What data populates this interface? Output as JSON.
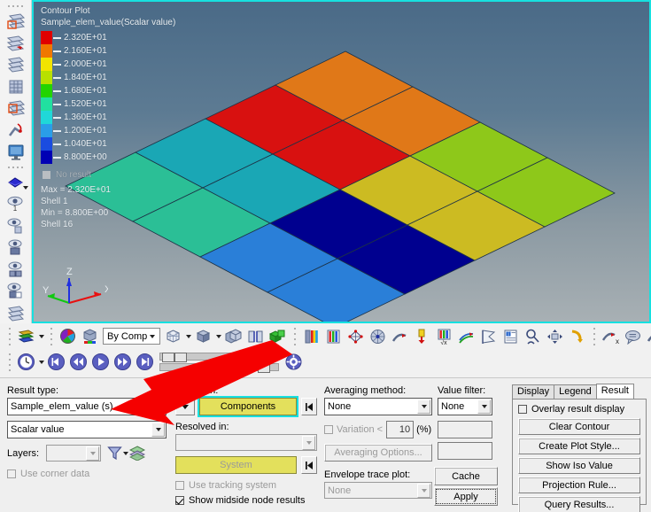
{
  "viewport": {
    "title_line1": "Contour Plot",
    "title_line2": "Sample_elem_value(Scalar value)",
    "no_result_label": "No result",
    "max_label": "Max = 2.320E+01",
    "max_entity": "Shell 1",
    "min_label": "Min = 8.800E+00",
    "min_entity": "Shell 16",
    "frame_color": "#17e0e0",
    "legend": [
      {
        "value": "2.320E+01",
        "color": "#e00000"
      },
      {
        "value": "2.160E+01",
        "color": "#f07800"
      },
      {
        "value": "2.000E+01",
        "color": "#f2e400"
      },
      {
        "value": "1.840E+01",
        "color": "#b8e000"
      },
      {
        "value": "1.680E+01",
        "color": "#22d400"
      },
      {
        "value": "1.520E+01",
        "color": "#21e0a0"
      },
      {
        "value": "1.360E+01",
        "color": "#20d8d8"
      },
      {
        "value": "1.200E+01",
        "color": "#2a9ee8"
      },
      {
        "value": "1.040E+01",
        "color": "#1a4ce0"
      },
      {
        "value": "8.800E+00",
        "color": "#0000b4"
      }
    ],
    "axis_triad": {
      "x_label": "X",
      "y_label": "Y",
      "z_label": "Z",
      "x_color": "#e81010",
      "y_color": "#10c810",
      "z_color": "#2030e0"
    }
  },
  "chart_data": {
    "type": "heatmap",
    "title": "Contour Plot - Sample_elem_value(Scalar value)",
    "rows": 4,
    "cols": 4,
    "vmin": 8.8,
    "vmax": 23.2,
    "cell_colors": [
      [
        "#2bbf96",
        "#1aa7b5",
        "#d81110",
        "#e07818"
      ],
      [
        "#2bbf96",
        "#1aa7b5",
        "#d81110",
        "#e07818"
      ],
      [
        "#2a7fd8",
        "#00008f",
        "#ccbb22",
        "#8ec81a"
      ],
      [
        "#2a7fd8",
        "#00008f",
        "#ccbb22",
        "#8ec81a"
      ]
    ],
    "legend_position": "left",
    "grid": false
  },
  "left_toolbar": {
    "items": [
      {
        "name": "create-plot-icon"
      },
      {
        "name": "apply-plot-icon"
      },
      {
        "name": "plot-list-icon"
      },
      {
        "name": "plot-table-icon"
      },
      {
        "name": "edit-plot-icon"
      },
      {
        "name": "vector-plot-icon"
      },
      {
        "name": "display-monitor-icon"
      },
      {
        "name": "iso-surface-icon"
      },
      {
        "name": "visibility-1-icon"
      },
      {
        "name": "visibility-copy-icon"
      },
      {
        "name": "visibility-group-icon"
      },
      {
        "name": "visibility-multi-icon"
      },
      {
        "name": "visibility-page-icon"
      },
      {
        "name": "mesh-sheet-icon"
      }
    ]
  },
  "toolbar": {
    "by_comp_label": "By Comp",
    "row1_icons": [
      "contour-plot-icon",
      "color-wheel-icon",
      "cube-legend-icon",
      "mesh-cube-icon",
      "solid-cube-icon",
      "stack-cube-icon",
      "section-cut-icon",
      "green-blocks-icon",
      "legend-bar-icon",
      "legend-columns-icon",
      "node-cross-icon",
      "mesh-ball-icon",
      "deform-arrow-icon",
      "load-arrow-icon",
      "value-axis-icon",
      "trace-arrows-icon",
      "flag-icon",
      "info-table-icon",
      "query-magnifier-icon",
      "expand-arrows-icon",
      "bend-arrow-icon",
      "deform-x-icon",
      "comment-icon",
      "curve-arrow-icon",
      "camera-icon",
      "plot-sheet-icon"
    ],
    "row2_icons": [
      "clock-icon",
      "first-frame-icon",
      "rewind-icon",
      "play-icon",
      "fast-forward-icon",
      "last-frame-icon",
      "settings-gear-icon"
    ]
  },
  "panel": {
    "result_type": {
      "label": "Result type:",
      "value": "Sample_elem_value (s)",
      "subtype_value": "Scalar value",
      "layers_label": "Layers:",
      "layers_value": "",
      "use_corner_data_label": "Use corner data",
      "use_corner_data_checked": false,
      "filter_icon": "funnel-filter-icon",
      "layers_icon": "layers-stack-icon"
    },
    "selection": {
      "label": "Selection:",
      "components_button": "Components",
      "resolved_in_label": "Resolved in:",
      "resolved_in_value": "",
      "system_button": "System",
      "use_tracking_label": "Use tracking system",
      "use_tracking_checked": false,
      "show_midside_label": "Show midside node results",
      "show_midside_checked": true
    },
    "averaging": {
      "label": "Averaging method:",
      "value": "None",
      "variation_label": "Variation <",
      "variation_value": "10",
      "variation_unit": "(%)",
      "variation_checked": false,
      "options_button": "Averaging Options...",
      "envelope_label": "Envelope trace plot:",
      "envelope_value": "None"
    },
    "value_filter": {
      "label": "Value filter:",
      "value": "None",
      "box1": "",
      "box2": ""
    },
    "actions": {
      "cache_button": "Cache",
      "apply_button": "Apply"
    },
    "tabs": [
      {
        "label": "Display",
        "active": false
      },
      {
        "label": "Legend",
        "active": false
      },
      {
        "label": "Result",
        "active": true
      }
    ],
    "result_tab": {
      "overlay_label": "Overlay result display",
      "overlay_checked": false,
      "buttons": [
        "Clear Contour",
        "Create Plot Style...",
        "Show Iso Value",
        "Projection Rule...",
        "Query Results..."
      ]
    }
  },
  "annotation": {
    "arrow_color": "#f50000",
    "name": "red-pointer-arrow"
  }
}
